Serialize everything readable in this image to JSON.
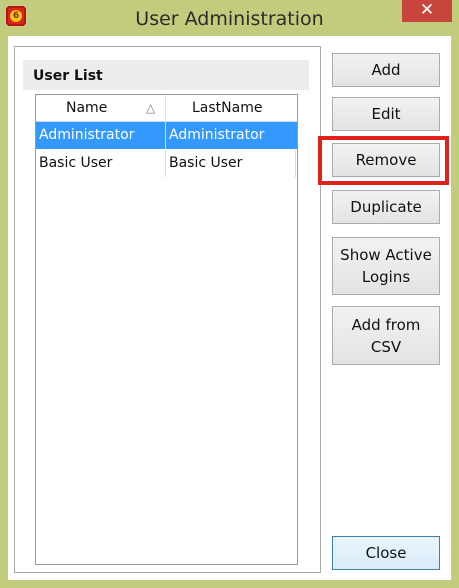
{
  "window": {
    "title": "User Administration",
    "close_glyph": "✕",
    "app_icon": "app-logo-icon",
    "app_icon_glyph": "6"
  },
  "group": {
    "title": "User List"
  },
  "list": {
    "columns": [
      "Name",
      "LastName"
    ],
    "sort_indicator": "△",
    "rows": [
      {
        "name": "Administrator",
        "last_name": "Administrator",
        "selected": true
      },
      {
        "name": "Basic User",
        "last_name": "Basic User",
        "selected": false
      }
    ]
  },
  "buttons": {
    "add": "Add",
    "edit": "Edit",
    "remove": "Remove",
    "duplicate": "Duplicate",
    "show_active_logins_line1": "Show Active",
    "show_active_logins_line2": "Logins",
    "add_from_csv_line1": "Add from",
    "add_from_csv_line2": "CSV",
    "close": "Close"
  },
  "colors": {
    "frame": "#c3cb7d",
    "selection": "#3399ff",
    "highlight": "#e0221c",
    "close_title_button": "#c7453c"
  }
}
